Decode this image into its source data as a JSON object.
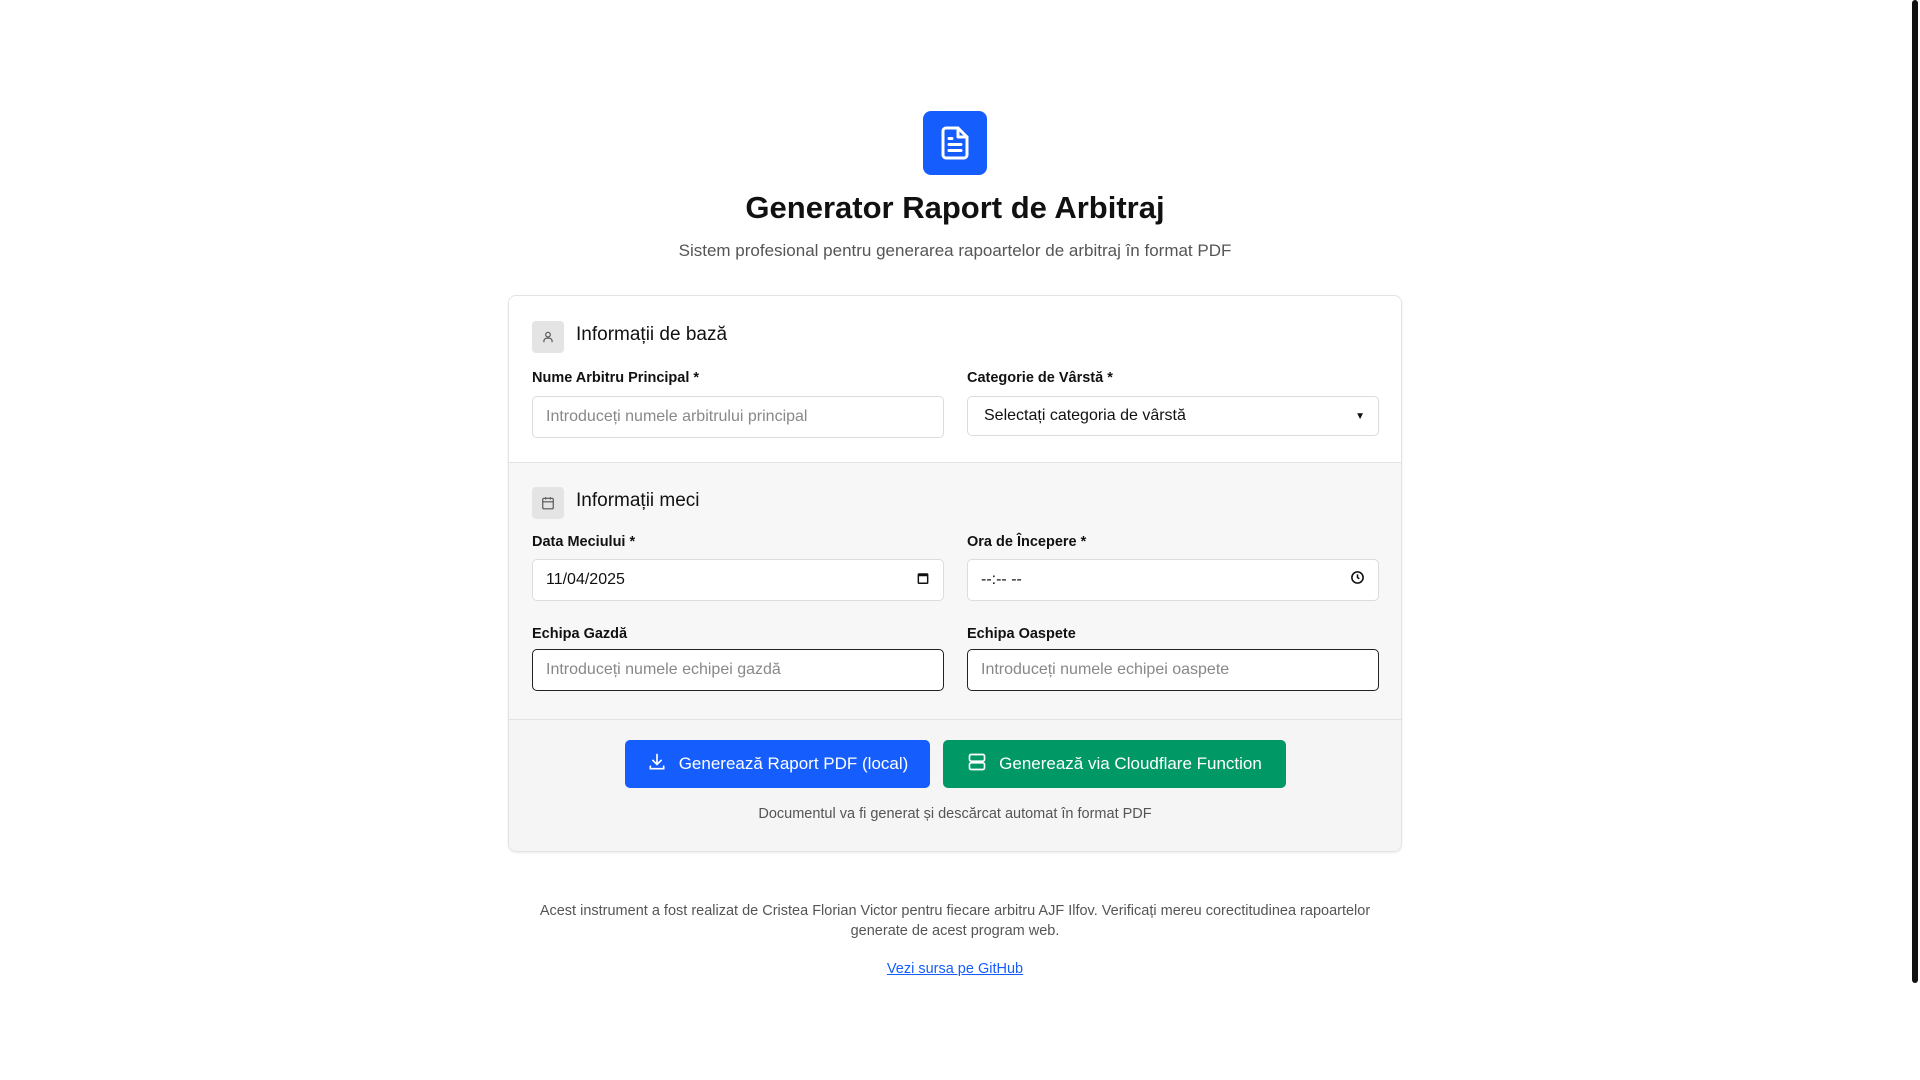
{
  "header": {
    "logo_icon": "document-icon",
    "title": "Generator Raport de Arbitraj",
    "subtitle": "Sistem profesional pentru generarea rapoartelor de arbitraj în format PDF"
  },
  "section_basic": {
    "icon": "user-icon",
    "title": "Informații de bază",
    "referee_label": "Nume Arbitru Principal *",
    "referee_placeholder": "Introduceți numele arbitrului principal",
    "category_label": "Categorie de Vârstă *",
    "category_selected": "Selectați categoria de vârstă"
  },
  "section_match": {
    "icon": "calendar-icon",
    "title": "Informații meci",
    "date_label": "Data Meciului *",
    "date_value": "11/04/2025",
    "time_label": "Ora de Începere *",
    "time_value": "--:-- --",
    "home_label": "Echipa Gazdă",
    "home_placeholder": "Introduceți numele echipei gazdă",
    "away_label": "Echipa Oaspete",
    "away_placeholder": "Introduceți numele echipei oaspete"
  },
  "actions": {
    "local_label": "Generează Raport PDF (local)",
    "cloud_label": "Generează via Cloudflare Function",
    "note": "Documentul va fi generat și descărcat automat în format PDF",
    "colors": {
      "primary": "#155dfc",
      "success": "#009966"
    }
  },
  "footer": {
    "text": "Acest instrument a fost realizat de Cristea Florian Victor pentru fiecare arbitru AJF Ilfov. Verificați mereu corectitudinea rapoartelor generate de acest program web.",
    "link": "Vezi sursa pe GitHub"
  }
}
